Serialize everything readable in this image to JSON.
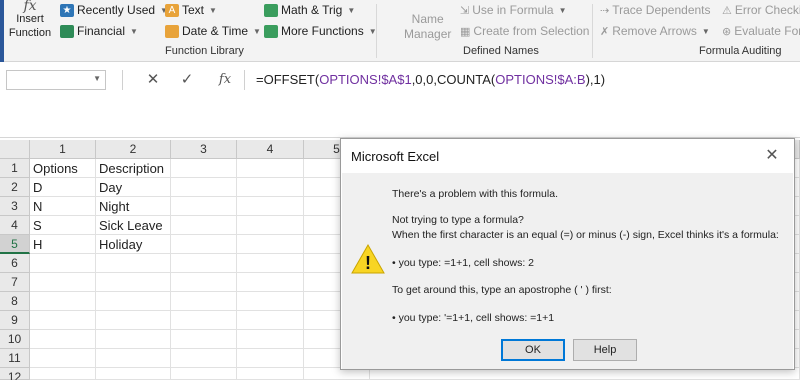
{
  "ribbon": {
    "insert_function": {
      "line1": "Insert",
      "line2": "Function"
    },
    "recently_used": "Recently Used",
    "financial": "Financial",
    "text": "Text",
    "date_time": "Date & Time",
    "math_trig": "Math & Trig",
    "more_functions": "More Functions",
    "function_library_label": "Function Library",
    "name_manager": {
      "line1": "Name",
      "line2": "Manager"
    },
    "use_in_formula": "Use in Formula",
    "create_from_selection": "Create from Selection",
    "defined_names_label": "Defined Names",
    "trace_dependents": "Trace Dependents",
    "remove_arrows": "Remove Arrows",
    "error_checking": "Error Checking",
    "evaluate_formula": "Evaluate Formula",
    "formula_auditing_label": "Formula Auditing"
  },
  "formula_bar": {
    "name_box": "",
    "cancel_glyph": "✕",
    "enter_glyph": "✓",
    "fx_glyph": "fx",
    "formula_parts": [
      "=OFFSET(",
      "OPTIONS!$A$1",
      ",0,0,COUNTA(",
      "OPTIONS!$A:B",
      "),1)"
    ]
  },
  "grid": {
    "columns": [
      "1",
      "2",
      "3",
      "4",
      "5"
    ],
    "rows": [
      "1",
      "2",
      "3",
      "4",
      "5",
      "6",
      "7",
      "8",
      "9",
      "10",
      "11",
      "12"
    ],
    "cells": [
      [
        "Options",
        "Description"
      ],
      [
        "D",
        "Day"
      ],
      [
        "N",
        "Night"
      ],
      [
        "S",
        "Sick Leave"
      ],
      [
        "H",
        "Holiday"
      ]
    ]
  },
  "dialog": {
    "title": "Microsoft Excel",
    "close": "✕",
    "line1": "There's a problem with this formula.",
    "line2": "Not trying to type a formula?",
    "line3": "When the first character is an equal (=) or minus (-) sign, Excel thinks it's a formula:",
    "line4": "• you type:   =1+1, cell shows:   2",
    "line5": "To get around this, type an apostrophe ( ' ) first:",
    "line6": "• you type:   '=1+1, cell shows:   =1+1",
    "ok": "OK",
    "help": "Help",
    "warning_icon": "warning-triangle",
    "warning_glyph": "!"
  },
  "colors": {
    "excel_green": "#217346",
    "ribbon_bg": "#f3f3f3",
    "ref_purple": "#7030a0",
    "warning_yellow": "#f8d523"
  }
}
